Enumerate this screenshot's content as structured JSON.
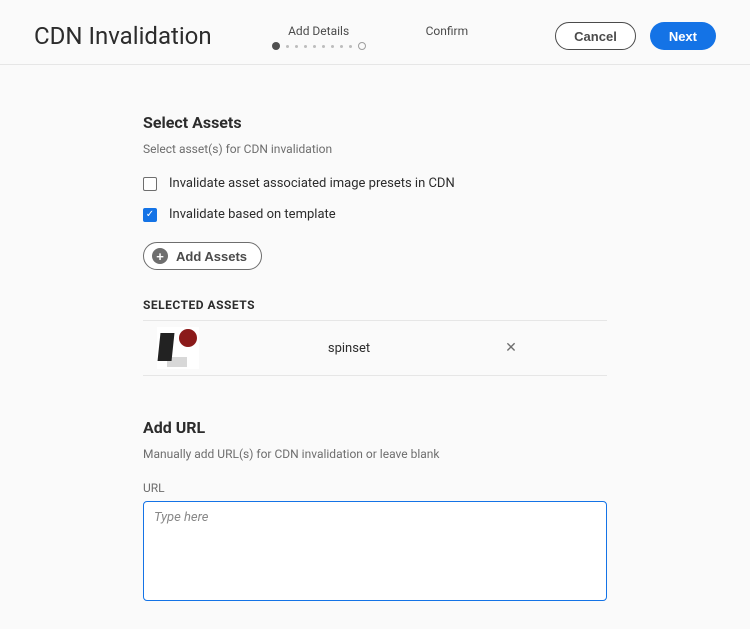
{
  "header": {
    "title": "CDN Invalidation",
    "steps": [
      "Add Details",
      "Confirm"
    ],
    "cancel_label": "Cancel",
    "next_label": "Next"
  },
  "select_assets": {
    "title": "Select Assets",
    "subtitle": "Select asset(s) for CDN invalidation",
    "check_presets": {
      "label": "Invalidate asset associated image presets in CDN",
      "checked": false
    },
    "check_template": {
      "label": "Invalidate based on template",
      "checked": true
    },
    "add_assets_label": "Add Assets",
    "selected_header": "SELECTED ASSETS",
    "selected": [
      {
        "name": "spinset"
      }
    ]
  },
  "add_url": {
    "title": "Add URL",
    "subtitle": "Manually add URL(s) for CDN invalidation or leave blank",
    "field_label": "URL",
    "placeholder": "Type here",
    "value": ""
  }
}
